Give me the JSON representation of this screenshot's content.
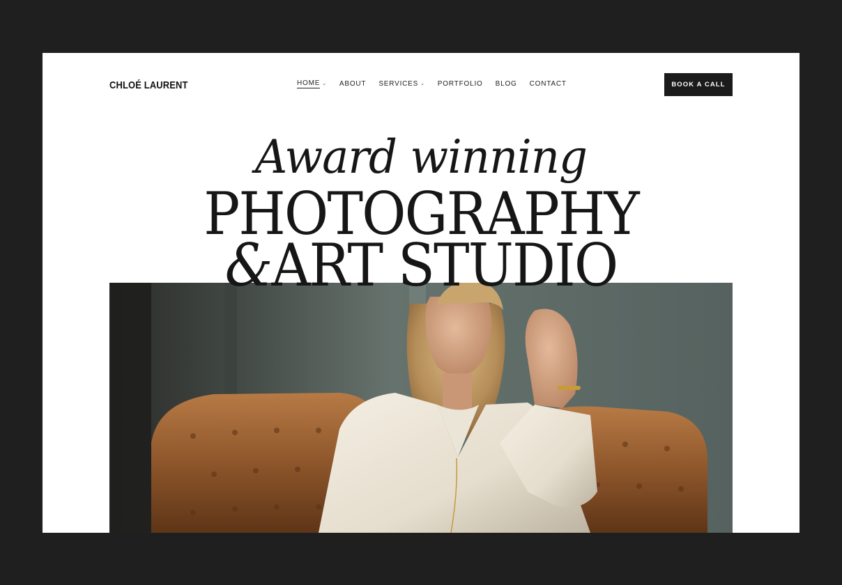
{
  "brand": {
    "name": "CHLOÉ LAURENT"
  },
  "nav": {
    "items": [
      {
        "label": "HOME",
        "active": true,
        "has_dropdown": true
      },
      {
        "label": "ABOUT",
        "active": false,
        "has_dropdown": false
      },
      {
        "label": "SERVICES",
        "active": false,
        "has_dropdown": true
      },
      {
        "label": "PORTFOLIO",
        "active": false,
        "has_dropdown": false
      },
      {
        "label": "BLOG",
        "active": false,
        "has_dropdown": false
      },
      {
        "label": "CONTACT",
        "active": false,
        "has_dropdown": false
      }
    ],
    "dropdown_icon": "chevron-down-icon"
  },
  "cta": {
    "label": "BOOK A CALL"
  },
  "hero": {
    "line1": "Award winning",
    "line2": "PHOTOGRAPHY",
    "line3_amp": "&",
    "line3": "ART STUDIO"
  },
  "colors": {
    "frame_background": "#1f1f1f",
    "page_background": "#ffffff",
    "text": "#161616",
    "button_background": "#1b1b1b",
    "button_text": "#ffffff"
  }
}
